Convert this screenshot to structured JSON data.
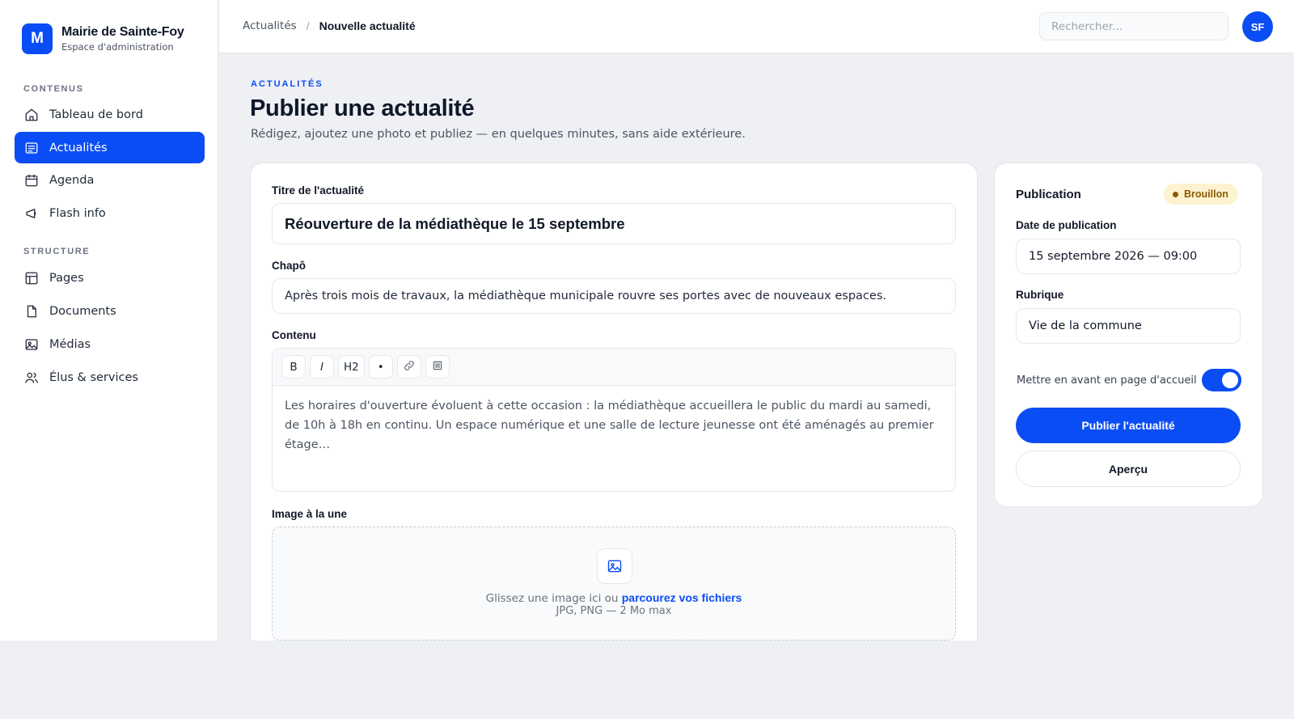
{
  "brand": {
    "logo_letter": "M",
    "title": "Mairie de Sainte-Foy",
    "subtitle": "Espace d'administration"
  },
  "sidebar": {
    "sections": [
      {
        "label": "CONTENUS"
      },
      {
        "label": "STRUCTURE"
      }
    ],
    "items": [
      {
        "label": "Tableau de bord",
        "icon": "home-icon"
      },
      {
        "label": "Actualités",
        "icon": "newspaper-icon",
        "active": true
      },
      {
        "label": "Agenda",
        "icon": "calendar-icon"
      },
      {
        "label": "Flash info",
        "icon": "megaphone-icon"
      },
      {
        "label": "Pages",
        "icon": "layout-icon"
      },
      {
        "label": "Documents",
        "icon": "file-icon"
      },
      {
        "label": "Médias",
        "icon": "image-icon"
      },
      {
        "label": "Élus & services",
        "icon": "users-icon"
      }
    ]
  },
  "header": {
    "breadcrumb": {
      "parent": "Actualités",
      "separator": "/",
      "current": "Nouvelle actualité"
    },
    "search": {
      "placeholder": "Rechercher...",
      "value": ""
    },
    "avatar_initials": "SF"
  },
  "page": {
    "eyebrow": "ACTUALITÉS",
    "title": "Publier une actualité",
    "subtitle": "Rédigez, ajoutez une photo et publiez — en quelques minutes, sans aide extérieure."
  },
  "form": {
    "title_label": "Titre de l'actualité",
    "title_value": "Réouverture de la médiathèque le 15 septembre",
    "chapo_label": "Chapô",
    "chapo_value": "Après trois mois de travaux, la médiathèque municipale rouvre ses portes avec de nouveaux espaces.",
    "content_label": "Contenu",
    "toolbar": {
      "bold": "B",
      "italic": "I",
      "heading": "H2",
      "bullet": "•",
      "link_icon": "link-icon",
      "list_icon": "align-icon"
    },
    "content_value": "Les horaires d'ouverture évoluent à cette occasion : la médiathèque accueillera le public du mardi au samedi, de 10h à 18h en continu. Un espace numérique et une salle de lecture jeunesse ont été aménagés au premier étage…",
    "image_label": "Image à la une",
    "dropzone": {
      "text": "Glissez une image ici ou ",
      "link": "parcourez vos fichiers",
      "hint": "JPG, PNG — 2 Mo max"
    }
  },
  "publication": {
    "title": "Publication",
    "status": "Brouillon",
    "date_label": "Date de publication",
    "date_value": "15 septembre 2026 — 09:00",
    "rubrique_label": "Rubrique",
    "rubrique_value": "Vie de la commune",
    "toggle_label": "Mettre en avant en page d'accueil",
    "toggle_on": true,
    "publish_label": "Publier l'actualité",
    "preview_label": "Aperçu"
  },
  "colors": {
    "accent": "#0b4df5",
    "badge_bg": "#fdf3d0",
    "badge_text": "#8a5a00",
    "page_bg": "#eef0f4"
  }
}
